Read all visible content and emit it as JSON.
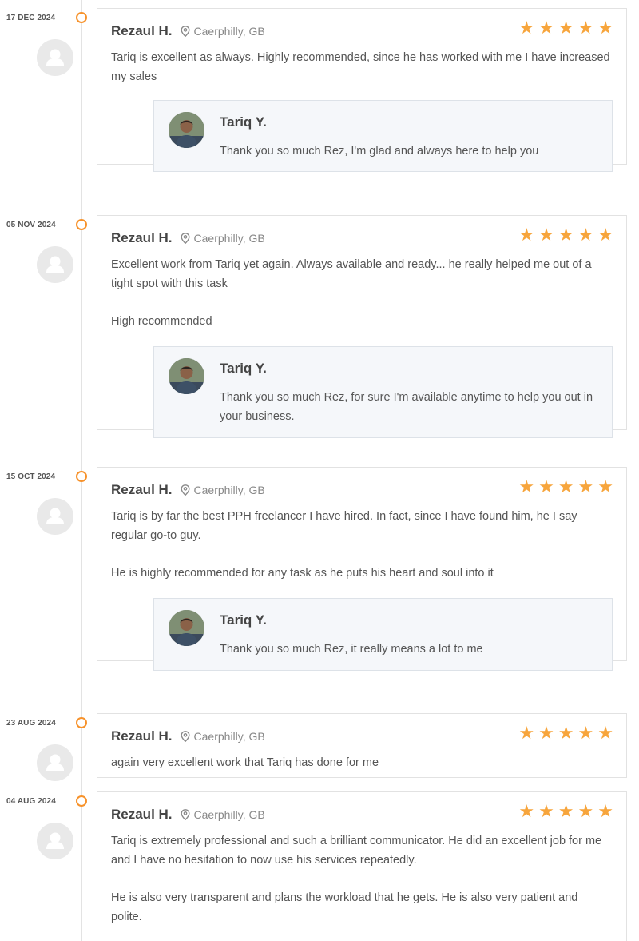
{
  "reviews": [
    {
      "date": "17 DEC 2024",
      "author": "Rezaul H.",
      "location": "Caerphilly, GB",
      "rating": 5,
      "paragraphs": [
        "Tariq is excellent as always. Highly recommended, since he has worked with me I have increased my sales"
      ],
      "reply": {
        "author": "Tariq Y.",
        "text": "Thank you so much Rez, I'm glad and always here to help you"
      }
    },
    {
      "date": "05 NOV 2024",
      "author": "Rezaul H.",
      "location": "Caerphilly, GB",
      "rating": 5,
      "paragraphs": [
        "Excellent work from Tariq yet again. Always available and ready... he really helped me out of a tight spot with this task",
        "High recommended"
      ],
      "reply": {
        "author": "Tariq Y.",
        "text": "Thank you so much Rez, for sure I'm available anytime to help you out in your business."
      }
    },
    {
      "date": "15 OCT 2024",
      "author": "Rezaul H.",
      "location": "Caerphilly, GB",
      "rating": 5,
      "paragraphs": [
        "Tariq is by far the best PPH freelancer I have hired. In fact, since I have found him, he I say regular go-to guy.",
        "He is highly recommended for any task as he puts his heart and soul into it"
      ],
      "reply": {
        "author": "Tariq Y.",
        "text": "Thank you so much Rez, it really means a lot to me"
      }
    },
    {
      "date": "23 AUG 2024",
      "author": "Rezaul H.",
      "location": "Caerphilly, GB",
      "rating": 5,
      "paragraphs": [
        "again very excellent work that Tariq has done for me"
      ]
    },
    {
      "date": "04 AUG 2024",
      "author": "Rezaul H.",
      "location": "Caerphilly, GB",
      "rating": 5,
      "paragraphs": [
        "Tariq is extremely professional and such a brilliant communicator. He did an excellent job for me and I have no hesitation to now use his services repeatedly.",
        "He is also very transparent and plans the workload that he gets. He is also very patient and polite."
      ]
    }
  ],
  "colors": {
    "accent": "#f7922b",
    "star": "#f7a53c"
  },
  "icons": {
    "location": "map-pin-icon",
    "rating": "star-icon",
    "avatar": "user-placeholder-icon"
  }
}
